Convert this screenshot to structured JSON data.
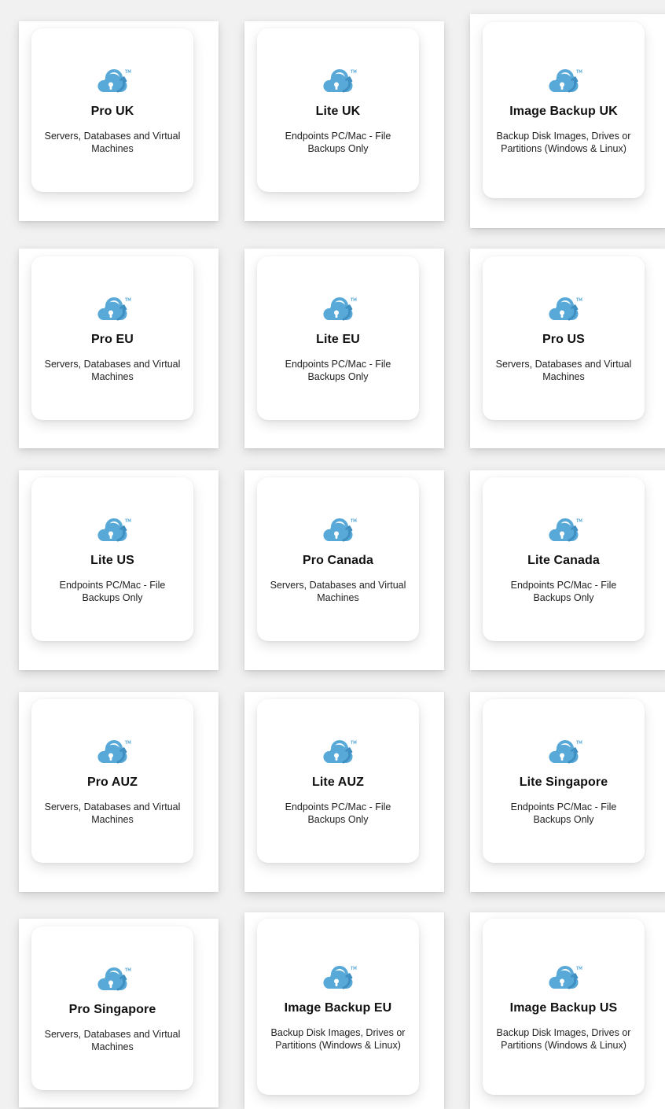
{
  "brand": {
    "accent": "#58a9d8",
    "accent_dark": "#3f8fc2"
  },
  "plans": [
    {
      "name": "Pro UK",
      "description": "Servers, Databases and Virtual Machines",
      "icon": "cloud-lock-icon"
    },
    {
      "name": "Lite UK",
      "description": "Endpoints PC/Mac - File Backups Only",
      "icon": "cloud-lock-icon"
    },
    {
      "name": "Image Backup UK",
      "description": "Backup Disk Images, Drives or Partitions (Windows & Linux)",
      "icon": "cloud-lock-icon"
    },
    {
      "name": "Pro EU",
      "description": "Servers, Databases and Virtual Machines",
      "icon": "cloud-lock-icon"
    },
    {
      "name": "Lite EU",
      "description": "Endpoints PC/Mac - File Backups Only",
      "icon": "cloud-lock-icon"
    },
    {
      "name": "Pro US",
      "description": "Servers, Databases and Virtual Machines",
      "icon": "cloud-lock-icon"
    },
    {
      "name": "Lite US",
      "description": "Endpoints PC/Mac - File Backups Only",
      "icon": "cloud-lock-icon"
    },
    {
      "name": "Pro Canada",
      "description": "Servers, Databases and Virtual Machines",
      "icon": "cloud-lock-icon"
    },
    {
      "name": "Lite Canada",
      "description": "Endpoints PC/Mac - File Backups Only",
      "icon": "cloud-lock-icon"
    },
    {
      "name": "Pro AUZ",
      "description": "Servers, Databases and Virtual Machines",
      "icon": "cloud-lock-icon"
    },
    {
      "name": "Lite AUZ",
      "description": "Endpoints PC/Mac - File Backups Only",
      "icon": "cloud-lock-icon"
    },
    {
      "name": "Lite Singapore",
      "description": "Endpoints PC/Mac - File Backups Only",
      "icon": "cloud-lock-icon"
    },
    {
      "name": "Pro Singapore",
      "description": "Servers, Databases and Virtual Machines",
      "icon": "cloud-lock-icon"
    },
    {
      "name": "Image Backup EU",
      "description": "Backup Disk Images, Drives or Partitions (Windows & Linux)",
      "icon": "cloud-lock-icon"
    },
    {
      "name": "Image Backup US",
      "description": "Backup Disk Images, Drives or Partitions (Windows & Linux)",
      "icon": "cloud-lock-icon"
    }
  ]
}
